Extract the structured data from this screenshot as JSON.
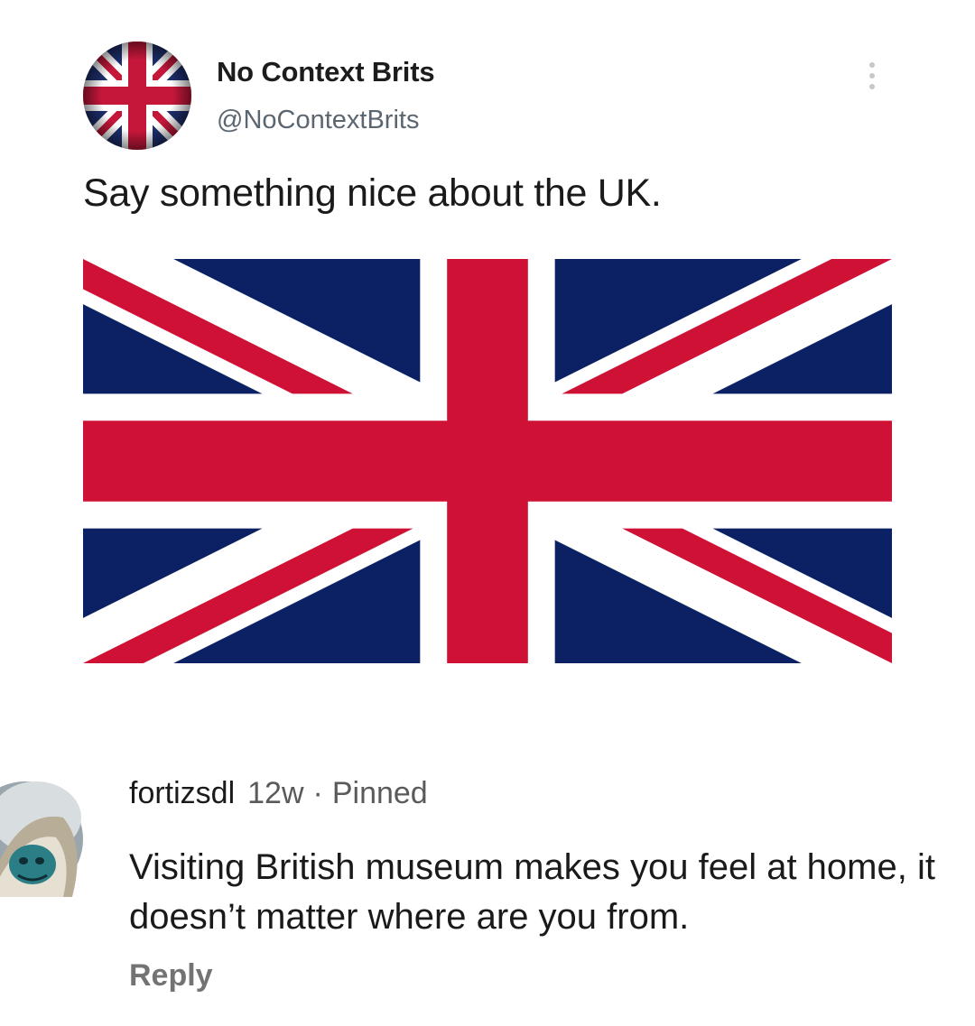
{
  "tweet": {
    "author_name": "No Context Brits",
    "author_handle": "@NoContextBrits",
    "text": "Say something nice about the UK.",
    "avatar_icon": "union-jack-avatar-icon",
    "more_icon": "more-vertical-icon",
    "image": "union-jack-flag"
  },
  "comment": {
    "username": "fortizsdl",
    "time": "12w",
    "separator": "·",
    "pinned": "Pinned",
    "text": "Visiting British museum makes you feel at home, it doesn’t matter where are you from.",
    "reply_label": "Reply",
    "avatar_icon": "hooded-figure-avatar-icon"
  },
  "colors": {
    "flag_blue": "#0b2164",
    "flag_red": "#cf1135",
    "flag_white": "#ffffff"
  }
}
